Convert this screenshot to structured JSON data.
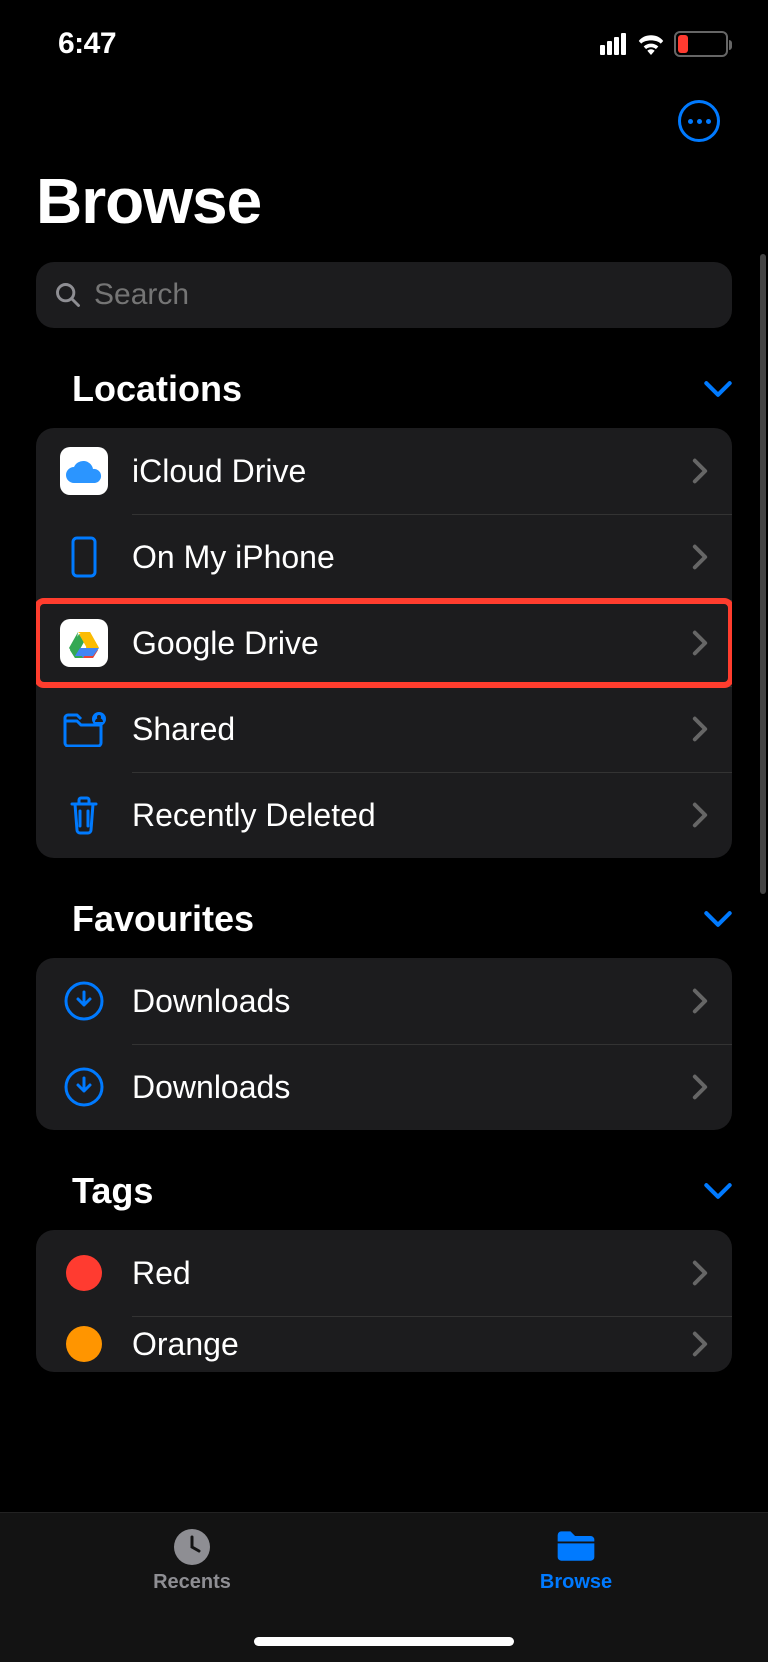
{
  "status": {
    "time": "6:47"
  },
  "header": {
    "title": "Browse"
  },
  "search": {
    "placeholder": "Search"
  },
  "sections": {
    "locations": {
      "label": "Locations",
      "items": [
        {
          "icon": "icloud",
          "label": "iCloud Drive"
        },
        {
          "icon": "iphone",
          "label": "On My iPhone"
        },
        {
          "icon": "gdrive",
          "label": "Google Drive",
          "highlighted": true
        },
        {
          "icon": "shared",
          "label": "Shared"
        },
        {
          "icon": "trash",
          "label": "Recently Deleted"
        }
      ]
    },
    "favourites": {
      "label": "Favourites",
      "items": [
        {
          "icon": "download",
          "label": "Downloads"
        },
        {
          "icon": "download",
          "label": "Downloads"
        }
      ]
    },
    "tags": {
      "label": "Tags",
      "items": [
        {
          "color": "#ff3b30",
          "label": "Red"
        },
        {
          "color": "#ff9500",
          "label": "Orange"
        }
      ]
    }
  },
  "tabbar": {
    "recents": "Recents",
    "browse": "Browse"
  }
}
